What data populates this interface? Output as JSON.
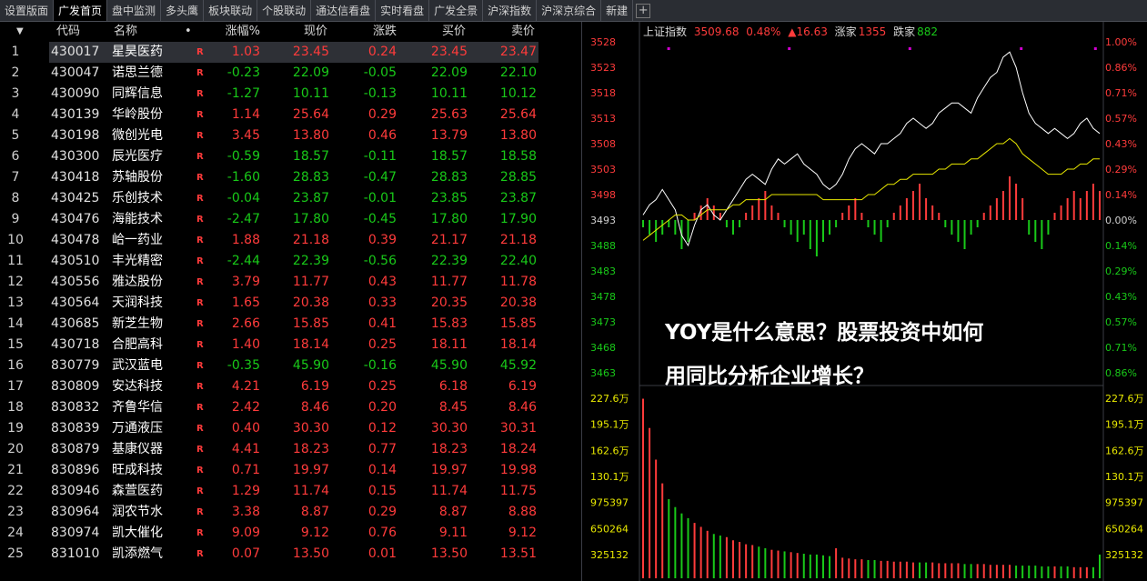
{
  "tabs": [
    {
      "label": "设置版面",
      "active": false
    },
    {
      "label": "广发首页",
      "active": true
    },
    {
      "label": "盘中监测",
      "active": false
    },
    {
      "label": "多头鹰",
      "active": false
    },
    {
      "label": "板块联动",
      "active": false
    },
    {
      "label": "个股联动",
      "active": false
    },
    {
      "label": "通达信看盘",
      "active": false
    },
    {
      "label": "实时看盘",
      "active": false
    },
    {
      "label": "广发全景",
      "active": false
    },
    {
      "label": "沪深指数",
      "active": false
    },
    {
      "label": "沪深京综合",
      "active": false
    },
    {
      "label": "新建",
      "active": false
    }
  ],
  "tab_plus": "+",
  "table": {
    "sort_arrow": "▼",
    "headers": {
      "code": "代码",
      "name": "名称",
      "dot": "•",
      "pct": "涨幅%",
      "price": "现价",
      "chg": "涨跌",
      "bid": "买价",
      "ask": "卖价"
    },
    "flag": "R",
    "rows": [
      {
        "idx": "1",
        "code": "430017",
        "name": "星昊医药",
        "pct": "1.03",
        "price": "23.45",
        "chg": "0.24",
        "bid": "23.45",
        "ask": "23.47",
        "dir": "up",
        "selected": true
      },
      {
        "idx": "2",
        "code": "430047",
        "name": "诺思兰德",
        "pct": "-0.23",
        "price": "22.09",
        "chg": "-0.05",
        "bid": "22.09",
        "ask": "22.10",
        "dir": "dn"
      },
      {
        "idx": "3",
        "code": "430090",
        "name": "同辉信息",
        "pct": "-1.27",
        "price": "10.11",
        "chg": "-0.13",
        "bid": "10.11",
        "ask": "10.12",
        "dir": "dn"
      },
      {
        "idx": "4",
        "code": "430139",
        "name": "华岭股份",
        "pct": "1.14",
        "price": "25.64",
        "chg": "0.29",
        "bid": "25.63",
        "ask": "25.64",
        "dir": "up"
      },
      {
        "idx": "5",
        "code": "430198",
        "name": "微创光电",
        "pct": "3.45",
        "price": "13.80",
        "chg": "0.46",
        "bid": "13.79",
        "ask": "13.80",
        "dir": "up"
      },
      {
        "idx": "6",
        "code": "430300",
        "name": "辰光医疗",
        "pct": "-0.59",
        "price": "18.57",
        "chg": "-0.11",
        "bid": "18.57",
        "ask": "18.58",
        "dir": "dn"
      },
      {
        "idx": "7",
        "code": "430418",
        "name": "苏轴股份",
        "pct": "-1.60",
        "price": "28.83",
        "chg": "-0.47",
        "bid": "28.83",
        "ask": "28.85",
        "dir": "dn"
      },
      {
        "idx": "8",
        "code": "430425",
        "name": "乐创技术",
        "pct": "-0.04",
        "price": "23.87",
        "chg": "-0.01",
        "bid": "23.85",
        "ask": "23.87",
        "dir": "dn"
      },
      {
        "idx": "9",
        "code": "430476",
        "name": "海能技术",
        "pct": "-2.47",
        "price": "17.80",
        "chg": "-0.45",
        "bid": "17.80",
        "ask": "17.90",
        "dir": "dn"
      },
      {
        "idx": "10",
        "code": "430478",
        "name": "峆一药业",
        "pct": "1.88",
        "price": "21.18",
        "chg": "0.39",
        "bid": "21.17",
        "ask": "21.18",
        "dir": "up"
      },
      {
        "idx": "11",
        "code": "430510",
        "name": "丰光精密",
        "pct": "-2.44",
        "price": "22.39",
        "chg": "-0.56",
        "bid": "22.39",
        "ask": "22.40",
        "dir": "dn"
      },
      {
        "idx": "12",
        "code": "430556",
        "name": "雅达股份",
        "pct": "3.79",
        "price": "11.77",
        "chg": "0.43",
        "bid": "11.77",
        "ask": "11.78",
        "dir": "up"
      },
      {
        "idx": "13",
        "code": "430564",
        "name": "天润科技",
        "pct": "1.65",
        "price": "20.38",
        "chg": "0.33",
        "bid": "20.35",
        "ask": "20.38",
        "dir": "up"
      },
      {
        "idx": "14",
        "code": "430685",
        "name": "新芝生物",
        "pct": "2.66",
        "price": "15.85",
        "chg": "0.41",
        "bid": "15.83",
        "ask": "15.85",
        "dir": "up"
      },
      {
        "idx": "15",
        "code": "430718",
        "name": "合肥高科",
        "pct": "1.40",
        "price": "18.14",
        "chg": "0.25",
        "bid": "18.11",
        "ask": "18.14",
        "dir": "up"
      },
      {
        "idx": "16",
        "code": "830779",
        "name": "武汉蓝电",
        "pct": "-0.35",
        "price": "45.90",
        "chg": "-0.16",
        "bid": "45.90",
        "ask": "45.92",
        "dir": "dn"
      },
      {
        "idx": "17",
        "code": "830809",
        "name": "安达科技",
        "pct": "4.21",
        "price": "6.19",
        "chg": "0.25",
        "bid": "6.18",
        "ask": "6.19",
        "dir": "up"
      },
      {
        "idx": "18",
        "code": "830832",
        "name": "齐鲁华信",
        "pct": "2.42",
        "price": "8.46",
        "chg": "0.20",
        "bid": "8.45",
        "ask": "8.46",
        "dir": "up"
      },
      {
        "idx": "19",
        "code": "830839",
        "name": "万通液压",
        "pct": "0.40",
        "price": "30.30",
        "chg": "0.12",
        "bid": "30.30",
        "ask": "30.31",
        "dir": "up"
      },
      {
        "idx": "20",
        "code": "830879",
        "name": "基康仪器",
        "pct": "4.41",
        "price": "18.23",
        "chg": "0.77",
        "bid": "18.23",
        "ask": "18.24",
        "dir": "up"
      },
      {
        "idx": "21",
        "code": "830896",
        "name": "旺成科技",
        "pct": "0.71",
        "price": "19.97",
        "chg": "0.14",
        "bid": "19.97",
        "ask": "19.98",
        "dir": "up"
      },
      {
        "idx": "22",
        "code": "830946",
        "name": "森萱医药",
        "pct": "1.29",
        "price": "11.74",
        "chg": "0.15",
        "bid": "11.74",
        "ask": "11.75",
        "dir": "up"
      },
      {
        "idx": "23",
        "code": "830964",
        "name": "润农节水",
        "pct": "3.38",
        "price": "8.87",
        "chg": "0.29",
        "bid": "8.87",
        "ask": "8.88",
        "dir": "up"
      },
      {
        "idx": "24",
        "code": "830974",
        "name": "凯大催化",
        "pct": "9.09",
        "price": "9.12",
        "chg": "0.76",
        "bid": "9.11",
        "ask": "9.12",
        "dir": "up"
      },
      {
        "idx": "25",
        "code": "831010",
        "name": "凯添燃气",
        "pct": "0.07",
        "price": "13.50",
        "chg": "0.01",
        "bid": "13.50",
        "ask": "13.51",
        "dir": "up"
      }
    ]
  },
  "chart": {
    "legend": {
      "index_name": "上证指数",
      "value": "3509.68",
      "pct": "0.48%",
      "change": "▲16.63",
      "up_label": "涨家",
      "up_count": "1355",
      "down_label": "跌家",
      "down_count": "882"
    },
    "overlay_line1": "YOY是什么意思？股票投资中如何",
    "overlay_line2": "用同比分析企业增长？",
    "colors": {
      "up": "#ff3b3b",
      "down": "#19c919",
      "price_line": "#ffffff",
      "avg_line": "#e8e800",
      "axis_text_left": "#ff3b3b",
      "volume_axis": "#e8e800",
      "marker": "#d000d0"
    }
  },
  "chart_data": {
    "type": "line",
    "title": "上证指数",
    "price_axis": {
      "labels": [
        "3528",
        "3523",
        "3518",
        "3513",
        "3508",
        "3503",
        "3498",
        "3493",
        "3488",
        "3483",
        "3478",
        "3473",
        "3468",
        "3463"
      ],
      "range": [
        3463,
        3528
      ],
      "base": 3493
    },
    "pct_axis": {
      "labels": [
        "1.00%",
        "0.86%",
        "0.71%",
        "0.57%",
        "0.43%",
        "0.29%",
        "0.14%",
        "0.00%",
        "0.14%",
        "0.29%",
        "0.43%",
        "0.57%",
        "0.71%",
        "0.86%"
      ]
    },
    "volume_axis": {
      "labels": [
        "227.6万",
        "195.1万",
        "162.6万",
        "130.1万",
        "975397",
        "650264",
        "325132"
      ],
      "range": [
        0,
        2276000
      ]
    },
    "series": [
      {
        "name": "price",
        "values": [
          3494,
          3496,
          3497,
          3499,
          3497,
          3495,
          3490,
          3488,
          3492,
          3495,
          3496,
          3494,
          3493,
          3495,
          3497,
          3499,
          3501,
          3502,
          3501,
          3500,
          3503,
          3505,
          3504,
          3505,
          3506,
          3504,
          3503,
          3502,
          3500,
          3499,
          3500,
          3502,
          3505,
          3507,
          3508,
          3507,
          3506,
          3508,
          3508,
          3509,
          3510,
          3512,
          3513,
          3512,
          3511,
          3512,
          3514,
          3515,
          3516,
          3516,
          3515,
          3514,
          3517,
          3519,
          3521,
          3522,
          3525,
          3526,
          3523,
          3518,
          3514,
          3512,
          3511,
          3510,
          3511,
          3510,
          3509,
          3510,
          3512,
          3513,
          3511,
          3510
        ]
      },
      {
        "name": "avg",
        "values": [
          3489,
          3490,
          3491,
          3492,
          3493,
          3494,
          3494,
          3493,
          3493,
          3494,
          3495,
          3495,
          3495,
          3495,
          3496,
          3496,
          3497,
          3497,
          3497,
          3497,
          3498,
          3498,
          3498,
          3498,
          3498,
          3498,
          3498,
          3498,
          3497,
          3497,
          3497,
          3497,
          3497,
          3497,
          3497,
          3498,
          3498,
          3499,
          3500,
          3500,
          3501,
          3501,
          3502,
          3502,
          3502,
          3502,
          3503,
          3503,
          3504,
          3504,
          3504,
          3505,
          3505,
          3506,
          3507,
          3508,
          3508,
          3509,
          3508,
          3506,
          3505,
          3504,
          3503,
          3502,
          3502,
          3502,
          3503,
          3503,
          3504,
          3504,
          3505,
          3505
        ]
      }
    ],
    "breadth": [
      -1,
      -2,
      -3,
      -2,
      -1,
      -2,
      -4,
      -3,
      1,
      2,
      3,
      2,
      1,
      -1,
      -2,
      -1,
      1,
      2,
      3,
      4,
      2,
      1,
      -1,
      -2,
      -3,
      -2,
      -4,
      -5,
      -3,
      -2,
      -1,
      1,
      2,
      3,
      1,
      -1,
      -2,
      -3,
      -1,
      1,
      2,
      3,
      4,
      5,
      3,
      2,
      1,
      -1,
      -2,
      -3,
      -4,
      -2,
      -1,
      1,
      2,
      3,
      4,
      6,
      5,
      3,
      -2,
      -3,
      -4,
      -2,
      1,
      2,
      3,
      4,
      3,
      4,
      5,
      4
    ],
    "volume": [
      2270000,
      1900000,
      1500000,
      1200000,
      1000000,
      900000,
      820000,
      760000,
      700000,
      650000,
      600000,
      560000,
      540000,
      520000,
      480000,
      460000,
      430000,
      420000,
      400000,
      380000,
      360000,
      350000,
      340000,
      330000,
      320000,
      310000,
      300000,
      300000,
      290000,
      280000,
      380000,
      260000,
      250000,
      240000,
      240000,
      230000,
      230000,
      220000,
      220000,
      210000,
      210000,
      210000,
      200000,
      200000,
      200000,
      200000,
      190000,
      190000,
      190000,
      190000,
      180000,
      180000,
      180000,
      180000,
      170000,
      170000,
      170000,
      170000,
      160000,
      160000,
      160000,
      160000,
      150000,
      150000,
      150000,
      150000,
      150000,
      140000,
      140000,
      140000,
      140000,
      300000
    ]
  }
}
